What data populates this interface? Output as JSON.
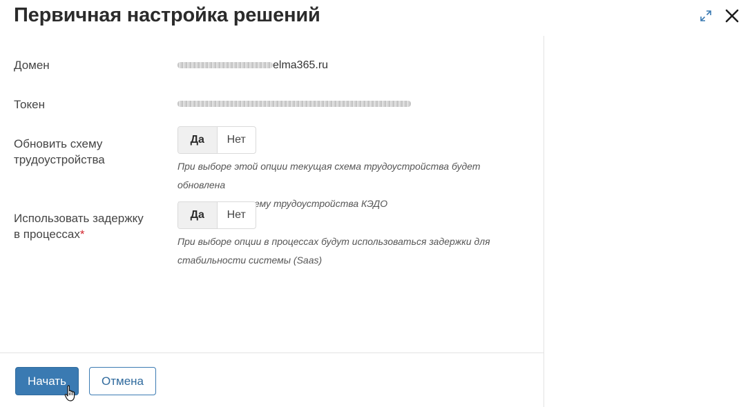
{
  "dialog": {
    "title": "Первичная настройка решений"
  },
  "fields": {
    "domain": {
      "label": "Домен",
      "value_visible": "elma365.ru"
    },
    "token": {
      "label": "Токен"
    },
    "update_scheme": {
      "label": "Обновить схему трудоустройства",
      "options": [
        "Да",
        "Нет"
      ],
      "selected": "Да",
      "hint_line1": "При выборе этой опции текущая схема трудоустройства будет обновлена",
      "hint_line2": "и заменена на схему трудоустройства КЭДО"
    },
    "use_delay": {
      "label_line1": "Использовать задержку",
      "label_line2": "в процессах",
      "required_mark": "*",
      "options": [
        "Да",
        "Нет"
      ],
      "selected": "Да",
      "hint_line1": "При выборе опции в процессах будут использоваться задержки для",
      "hint_line2": "стабильности системы (Saas)"
    }
  },
  "footer": {
    "start_label": "Начать",
    "cancel_label": "Отмена"
  },
  "icons": {
    "expand": "expand-icon",
    "close": "close-icon",
    "cursor": "hand-pointer-icon"
  },
  "colors": {
    "primary": "#3a7ab2",
    "required": "#d2262f",
    "icon_blue": "#3a7ab2"
  }
}
